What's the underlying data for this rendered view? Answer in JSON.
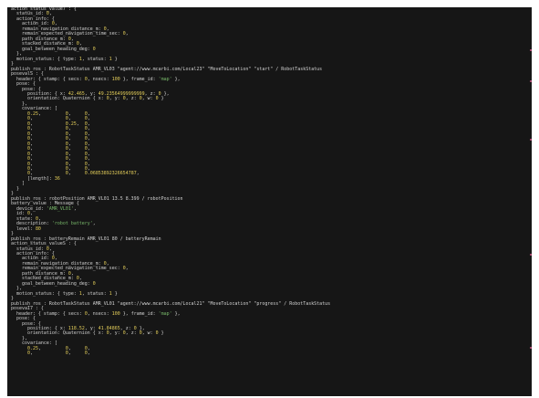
{
  "terminal": {
    "lines": [
      [
        {
          "t": "action_status_value7 : {",
          "c": "kw"
        }
      ],
      [
        {
          "t": "  status_id: ",
          "c": "kw"
        },
        {
          "t": "0",
          "c": "num"
        },
        {
          "t": ",",
          "c": "kw"
        }
      ],
      [
        {
          "t": "  action_info: {",
          "c": "kw"
        }
      ],
      [
        {
          "t": "    action_id: ",
          "c": "kw"
        },
        {
          "t": "0",
          "c": "num"
        },
        {
          "t": ",",
          "c": "kw"
        }
      ],
      [
        {
          "t": "    remain_navigation_distance_m: ",
          "c": "kw"
        },
        {
          "t": "0",
          "c": "num"
        },
        {
          "t": ",",
          "c": "kw"
        }
      ],
      [
        {
          "t": "    remain_expected_navigation_time_sec: ",
          "c": "kw"
        },
        {
          "t": "0",
          "c": "num"
        },
        {
          "t": ",",
          "c": "kw"
        }
      ],
      [
        {
          "t": "    path_distance_m: ",
          "c": "kw"
        },
        {
          "t": "0",
          "c": "num"
        },
        {
          "t": ",",
          "c": "kw"
        }
      ],
      [
        {
          "t": "    stacked_distance_m: ",
          "c": "kw"
        },
        {
          "t": "0",
          "c": "num"
        },
        {
          "t": ",",
          "c": "kw"
        }
      ],
      [
        {
          "t": "    goal_between_heading_deg: ",
          "c": "kw"
        },
        {
          "t": "0",
          "c": "num"
        }
      ],
      [
        {
          "t": "  },",
          "c": "kw"
        }
      ],
      [
        {
          "t": "  motion_status: { type: ",
          "c": "kw"
        },
        {
          "t": "1",
          "c": "num"
        },
        {
          "t": ", status: ",
          "c": "kw"
        },
        {
          "t": "1",
          "c": "num"
        },
        {
          "t": " }",
          "c": "kw"
        }
      ],
      [
        {
          "t": "}",
          "c": "kw"
        }
      ],
      [
        {
          "t": "publish_ros : RobotTaskStatus AMR_VL03 \"agent://www.mcarbi.com/Local23\" \"MoveToLocation\" \"start\" / RobotTaskStatus",
          "c": "kw"
        }
      ],
      [
        {
          "t": "posevalS : {",
          "c": "kw"
        }
      ],
      [
        {
          "t": "  header: { stamp: { secs: ",
          "c": "kw"
        },
        {
          "t": "0",
          "c": "num"
        },
        {
          "t": ", nsecs: ",
          "c": "kw"
        },
        {
          "t": "100",
          "c": "num"
        },
        {
          "t": " }, frame_id: ",
          "c": "kw"
        },
        {
          "t": "'map'",
          "c": "str"
        },
        {
          "t": " },",
          "c": "kw"
        }
      ],
      [
        {
          "t": "  pose: {",
          "c": "kw"
        }
      ],
      [
        {
          "t": "    pose: {",
          "c": "kw"
        }
      ],
      [
        {
          "t": "      position: { x: ",
          "c": "kw"
        },
        {
          "t": "42.465",
          "c": "num"
        },
        {
          "t": ", y: ",
          "c": "kw"
        },
        {
          "t": "49.23564999999999",
          "c": "num"
        },
        {
          "t": ", z: ",
          "c": "kw"
        },
        {
          "t": "0",
          "c": "num"
        },
        {
          "t": " },",
          "c": "kw"
        }
      ],
      [
        {
          "t": "      orientation: Quaternion { x: ",
          "c": "kw"
        },
        {
          "t": "0",
          "c": "num"
        },
        {
          "t": ", y: ",
          "c": "kw"
        },
        {
          "t": "0",
          "c": "num"
        },
        {
          "t": ", z: ",
          "c": "kw"
        },
        {
          "t": "0",
          "c": "num"
        },
        {
          "t": ", w: ",
          "c": "kw"
        },
        {
          "t": "0",
          "c": "num"
        },
        {
          "t": " }",
          "c": "kw"
        }
      ],
      [
        {
          "t": "    },",
          "c": "kw"
        }
      ],
      [
        {
          "t": "    covariance: [",
          "c": "kw"
        }
      ],
      [
        {
          "t": "      ",
          "c": "kw"
        },
        {
          "t": "0.25",
          "c": "num"
        },
        {
          "t": ",         ",
          "c": "kw"
        },
        {
          "t": "0",
          "c": "num"
        },
        {
          "t": ",     ",
          "c": "kw"
        },
        {
          "t": "0",
          "c": "num"
        },
        {
          "t": ",",
          "c": "kw"
        }
      ],
      [
        {
          "t": "      ",
          "c": "kw"
        },
        {
          "t": "0",
          "c": "num"
        },
        {
          "t": ",            ",
          "c": "kw"
        },
        {
          "t": "0",
          "c": "num"
        },
        {
          "t": ",     ",
          "c": "kw"
        },
        {
          "t": "0",
          "c": "num"
        },
        {
          "t": ",",
          "c": "kw"
        }
      ],
      [
        {
          "t": "      ",
          "c": "kw"
        },
        {
          "t": "0",
          "c": "num"
        },
        {
          "t": ",            ",
          "c": "kw"
        },
        {
          "t": "0.25",
          "c": "num"
        },
        {
          "t": ",  ",
          "c": "kw"
        },
        {
          "t": "0",
          "c": "num"
        },
        {
          "t": ",",
          "c": "kw"
        }
      ],
      [
        {
          "t": "      ",
          "c": "kw"
        },
        {
          "t": "0",
          "c": "num"
        },
        {
          "t": ",            ",
          "c": "kw"
        },
        {
          "t": "0",
          "c": "num"
        },
        {
          "t": ",     ",
          "c": "kw"
        },
        {
          "t": "0",
          "c": "num"
        },
        {
          "t": ",",
          "c": "kw"
        }
      ],
      [
        {
          "t": "      ",
          "c": "kw"
        },
        {
          "t": "0",
          "c": "num"
        },
        {
          "t": ",            ",
          "c": "kw"
        },
        {
          "t": "0",
          "c": "num"
        },
        {
          "t": ",     ",
          "c": "kw"
        },
        {
          "t": "0",
          "c": "num"
        },
        {
          "t": ",",
          "c": "kw"
        }
      ],
      [
        {
          "t": "      ",
          "c": "kw"
        },
        {
          "t": "0",
          "c": "num"
        },
        {
          "t": ",            ",
          "c": "kw"
        },
        {
          "t": "0",
          "c": "num"
        },
        {
          "t": ",     ",
          "c": "kw"
        },
        {
          "t": "0",
          "c": "num"
        },
        {
          "t": ",",
          "c": "kw"
        }
      ],
      [
        {
          "t": "      ",
          "c": "kw"
        },
        {
          "t": "0",
          "c": "num"
        },
        {
          "t": ",            ",
          "c": "kw"
        },
        {
          "t": "0",
          "c": "num"
        },
        {
          "t": ",     ",
          "c": "kw"
        },
        {
          "t": "0",
          "c": "num"
        },
        {
          "t": ",",
          "c": "kw"
        }
      ],
      [
        {
          "t": "      ",
          "c": "kw"
        },
        {
          "t": "0",
          "c": "num"
        },
        {
          "t": ",            ",
          "c": "kw"
        },
        {
          "t": "0",
          "c": "num"
        },
        {
          "t": ",     ",
          "c": "kw"
        },
        {
          "t": "0",
          "c": "num"
        },
        {
          "t": ",",
          "c": "kw"
        }
      ],
      [
        {
          "t": "      ",
          "c": "kw"
        },
        {
          "t": "0",
          "c": "num"
        },
        {
          "t": ",            ",
          "c": "kw"
        },
        {
          "t": "0",
          "c": "num"
        },
        {
          "t": ",     ",
          "c": "kw"
        },
        {
          "t": "0",
          "c": "num"
        },
        {
          "t": ",",
          "c": "kw"
        }
      ],
      [
        {
          "t": "      ",
          "c": "kw"
        },
        {
          "t": "0",
          "c": "num"
        },
        {
          "t": ",            ",
          "c": "kw"
        },
        {
          "t": "0",
          "c": "num"
        },
        {
          "t": ",     ",
          "c": "kw"
        },
        {
          "t": "0",
          "c": "num"
        },
        {
          "t": ",",
          "c": "kw"
        }
      ],
      [
        {
          "t": "      ",
          "c": "kw"
        },
        {
          "t": "0",
          "c": "num"
        },
        {
          "t": ",            ",
          "c": "kw"
        },
        {
          "t": "0",
          "c": "num"
        },
        {
          "t": ",     ",
          "c": "kw"
        },
        {
          "t": "0",
          "c": "num"
        },
        {
          "t": ",",
          "c": "kw"
        }
      ],
      [
        {
          "t": "      ",
          "c": "kw"
        },
        {
          "t": "0",
          "c": "num"
        },
        {
          "t": ",            ",
          "c": "kw"
        },
        {
          "t": "0",
          "c": "num"
        },
        {
          "t": ",     ",
          "c": "kw"
        },
        {
          "t": "0",
          "c": "num"
        },
        {
          "t": ",",
          "c": "kw"
        }
      ],
      [
        {
          "t": "      ",
          "c": "kw"
        },
        {
          "t": "0",
          "c": "num"
        },
        {
          "t": ",            ",
          "c": "kw"
        },
        {
          "t": "0",
          "c": "num"
        },
        {
          "t": ",     ",
          "c": "kw"
        },
        {
          "t": "0.06853892326654787",
          "c": "num"
        },
        {
          "t": ",",
          "c": "kw"
        }
      ],
      [
        {
          "t": "      [length]: ",
          "c": "kw"
        },
        {
          "t": "36",
          "c": "num"
        }
      ],
      [
        {
          "t": "    ]",
          "c": "kw"
        }
      ],
      [
        {
          "t": "  }",
          "c": "kw"
        }
      ],
      [
        {
          "t": "}",
          "c": "kw"
        }
      ],
      [
        {
          "t": "publish_ros : robotPosition AMR_VL01 13.5 8.399 / robotPosition",
          "c": "kw"
        }
      ],
      [
        {
          "t": "battery_value : Message {",
          "c": "kw"
        }
      ],
      [
        {
          "t": "  device_id: ",
          "c": "kw"
        },
        {
          "t": "'AMR_VL01'",
          "c": "str"
        },
        {
          "t": ",",
          "c": "kw"
        }
      ],
      [
        {
          "t": "  id: ",
          "c": "kw"
        },
        {
          "t": "0",
          "c": "num"
        },
        {
          "t": ",",
          "c": "kw"
        }
      ],
      [
        {
          "t": "  state: ",
          "c": "kw"
        },
        {
          "t": "0",
          "c": "num"
        },
        {
          "t": ",",
          "c": "kw"
        }
      ],
      [
        {
          "t": "  description: ",
          "c": "kw"
        },
        {
          "t": "'robot battery'",
          "c": "str"
        },
        {
          "t": ",",
          "c": "kw"
        }
      ],
      [
        {
          "t": "  level: ",
          "c": "kw"
        },
        {
          "t": "80",
          "c": "num"
        }
      ],
      [
        {
          "t": "}",
          "c": "kw"
        }
      ],
      [
        {
          "t": "publish_ros : batteryRemain AMR_VL01 80 / batteryRemain",
          "c": "kw"
        }
      ],
      [
        {
          "t": "action_status_valueS : {",
          "c": "kw"
        }
      ],
      [
        {
          "t": "  status_id: ",
          "c": "kw"
        },
        {
          "t": "0",
          "c": "num"
        },
        {
          "t": ",",
          "c": "kw"
        }
      ],
      [
        {
          "t": "  action_info: {",
          "c": "kw"
        }
      ],
      [
        {
          "t": "    action_id: ",
          "c": "kw"
        },
        {
          "t": "0",
          "c": "num"
        },
        {
          "t": ",",
          "c": "kw"
        }
      ],
      [
        {
          "t": "    remain_navigation_distance_m: ",
          "c": "kw"
        },
        {
          "t": "0",
          "c": "num"
        },
        {
          "t": ",",
          "c": "kw"
        }
      ],
      [
        {
          "t": "    remain_expected_navigation_time_sec: ",
          "c": "kw"
        },
        {
          "t": "0",
          "c": "num"
        },
        {
          "t": ",",
          "c": "kw"
        }
      ],
      [
        {
          "t": "    path_distance_m: ",
          "c": "kw"
        },
        {
          "t": "0",
          "c": "num"
        },
        {
          "t": ",",
          "c": "kw"
        }
      ],
      [
        {
          "t": "    stacked_distance_m: ",
          "c": "kw"
        },
        {
          "t": "0",
          "c": "num"
        },
        {
          "t": ",",
          "c": "kw"
        }
      ],
      [
        {
          "t": "    goal_between_heading_deg: ",
          "c": "kw"
        },
        {
          "t": "0",
          "c": "num"
        }
      ],
      [
        {
          "t": "  },",
          "c": "kw"
        }
      ],
      [
        {
          "t": "  motion_status: { type: ",
          "c": "kw"
        },
        {
          "t": "1",
          "c": "num"
        },
        {
          "t": ", status: ",
          "c": "kw"
        },
        {
          "t": "1",
          "c": "num"
        },
        {
          "t": " }",
          "c": "kw"
        }
      ],
      [
        {
          "t": "}",
          "c": "kw"
        }
      ],
      [
        {
          "t": "publish_ros : RobotTaskStatus AMR_VL01 \"agent://www.mcarbi.com/Local21\" \"MoveToLocation\" \"progress\" / RobotTaskStatus",
          "c": "kw"
        }
      ],
      [
        {
          "t": "posevaI7 : {",
          "c": "kw"
        }
      ],
      [
        {
          "t": "  header: { stamp: { secs: ",
          "c": "kw"
        },
        {
          "t": "0",
          "c": "num"
        },
        {
          "t": ", nsecs: ",
          "c": "kw"
        },
        {
          "t": "100",
          "c": "num"
        },
        {
          "t": " }, frame_id: ",
          "c": "kw"
        },
        {
          "t": "'map'",
          "c": "str"
        },
        {
          "t": " },",
          "c": "kw"
        }
      ],
      [
        {
          "t": "  pose: {",
          "c": "kw"
        }
      ],
      [
        {
          "t": "    pose: {",
          "c": "kw"
        }
      ],
      [
        {
          "t": "      position: { x: ",
          "c": "kw"
        },
        {
          "t": "118.52",
          "c": "num"
        },
        {
          "t": ", y: ",
          "c": "kw"
        },
        {
          "t": "41.84865",
          "c": "num"
        },
        {
          "t": ", z: ",
          "c": "kw"
        },
        {
          "t": "0",
          "c": "num"
        },
        {
          "t": " },",
          "c": "kw"
        }
      ],
      [
        {
          "t": "      orientation: Quaternion { x: ",
          "c": "kw"
        },
        {
          "t": "0",
          "c": "num"
        },
        {
          "t": ", y: ",
          "c": "kw"
        },
        {
          "t": "0",
          "c": "num"
        },
        {
          "t": ", z: ",
          "c": "kw"
        },
        {
          "t": "0",
          "c": "num"
        },
        {
          "t": ", w: ",
          "c": "kw"
        },
        {
          "t": "0",
          "c": "num"
        },
        {
          "t": " }",
          "c": "kw"
        }
      ],
      [
        {
          "t": "    },",
          "c": "kw"
        }
      ],
      [
        {
          "t": "    covariance: [",
          "c": "kw"
        }
      ],
      [
        {
          "t": "      ",
          "c": "kw"
        },
        {
          "t": "0.25",
          "c": "num"
        },
        {
          "t": ",         ",
          "c": "kw"
        },
        {
          "t": "0",
          "c": "num"
        },
        {
          "t": ",     ",
          "c": "kw"
        },
        {
          "t": "0",
          "c": "num"
        },
        {
          "t": ",",
          "c": "kw"
        }
      ],
      [
        {
          "t": "      ",
          "c": "kw"
        },
        {
          "t": "0",
          "c": "num"
        },
        {
          "t": ",            ",
          "c": "kw"
        },
        {
          "t": "0",
          "c": "num"
        },
        {
          "t": ",     ",
          "c": "kw"
        },
        {
          "t": "0",
          "c": "num"
        },
        {
          "t": ",",
          "c": "kw"
        }
      ]
    ]
  },
  "colors": {
    "background": "#161616",
    "text": "#d2d2d2",
    "number": "#e5cf5a",
    "string": "#78b86a",
    "scroll_mark": "#a3466c"
  }
}
